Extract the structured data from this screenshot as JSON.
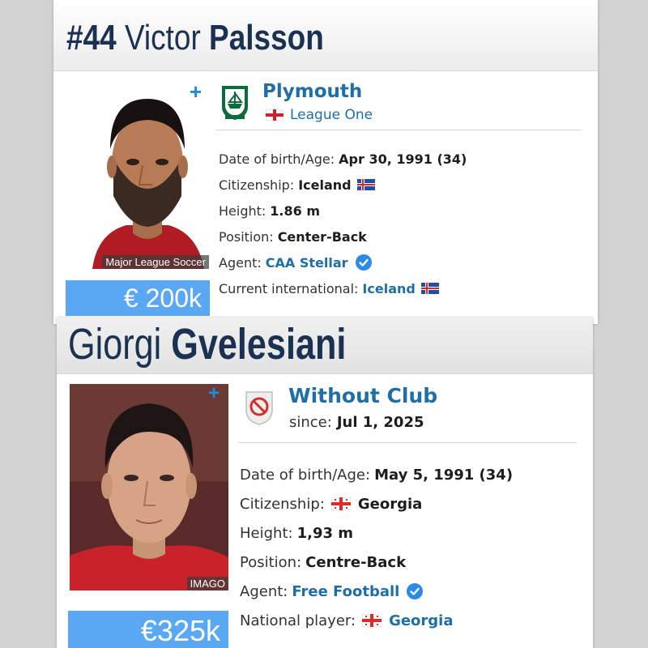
{
  "players": [
    {
      "number": "#44",
      "first_name": "Victor",
      "last_name": "Palsson",
      "photo_credit": "Major League Soccer",
      "market_value": "€ 200k",
      "club": {
        "name": "Plymouth",
        "sub_value": "League One",
        "sub_flag": "england-flag"
      },
      "facts": {
        "dob_label": "Date of birth/Age:",
        "dob_value": "Apr 30, 1991 (34)",
        "citizenship_label": "Citizenship:",
        "citizenship_value": "Iceland",
        "height_label": "Height:",
        "height_value": "1.86 m",
        "position_label": "Position:",
        "position_value": "Center-Back",
        "agent_label": "Agent:",
        "agent_value": "CAA Stellar",
        "international_label": "Current international:",
        "international_value": "Iceland"
      }
    },
    {
      "first_name": "Giorgi",
      "last_name": "Gvelesiani",
      "photo_credit": "IMAGO",
      "market_value": "€325k",
      "club": {
        "name": "Without Club",
        "sub_label": "since:",
        "sub_value": "Jul 1, 2025"
      },
      "facts": {
        "dob_label": "Date of birth/Age:",
        "dob_value": "May 5, 1991 (34)",
        "citizenship_label": "Citizenship:",
        "citizenship_value": "Georgia",
        "height_label": "Height:",
        "height_value": "1,93 m",
        "position_label": "Position:",
        "position_value": "Centre-Back",
        "agent_label": "Agent:",
        "agent_value": "Free Football",
        "international_label": "National player:",
        "international_value": "Georgia"
      }
    }
  ],
  "colors": {
    "link": "#1f6fa6",
    "value_box": "#5aa8f3",
    "name": "#1a3151",
    "add_icon": "#1a8fd6",
    "verified": "#2b8be6"
  }
}
